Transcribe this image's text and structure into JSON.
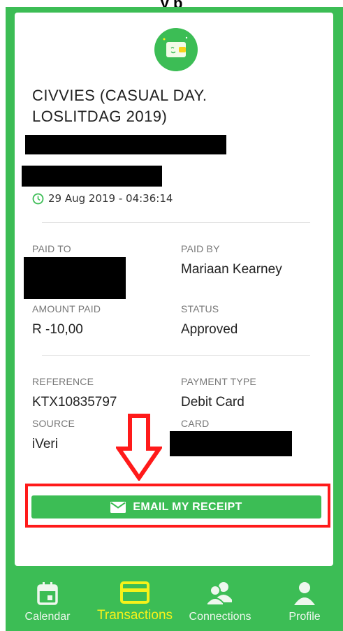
{
  "page_caption": "y   p",
  "transaction": {
    "title": "CIVVIES (CASUAL DAY. LOSLITDAG 2019)",
    "datetime": "29 Aug 2019 - 04:36:14",
    "paid_to_label": "PAID TO",
    "paid_by_label": "PAID BY",
    "paid_by_value": "Mariaan Kearney",
    "amount_paid_label": "AMOUNT PAID",
    "amount_paid_value": "R -10,00",
    "status_label": "STATUS",
    "status_value": "Approved",
    "reference_label": "REFERENCE",
    "reference_value": "KTX10835797",
    "payment_type_label": "PAYMENT TYPE",
    "payment_type_value": "Debit Card",
    "source_label": "SOURCE",
    "source_value": "iVeri",
    "card_label": "CARD"
  },
  "email_button": {
    "label": "EMAIL MY RECEIPT"
  },
  "nav": {
    "items": [
      {
        "label": "Calendar",
        "icon": "calendar-icon"
      },
      {
        "label": "Transactions",
        "icon": "card-icon",
        "active": true
      },
      {
        "label": "Connections",
        "icon": "connections-icon"
      },
      {
        "label": "Profile",
        "icon": "profile-icon"
      }
    ]
  },
  "colors": {
    "brand_green": "#3cbd55",
    "active_nav": "#f6f21a",
    "annotation_red": "#ff1a1a"
  }
}
